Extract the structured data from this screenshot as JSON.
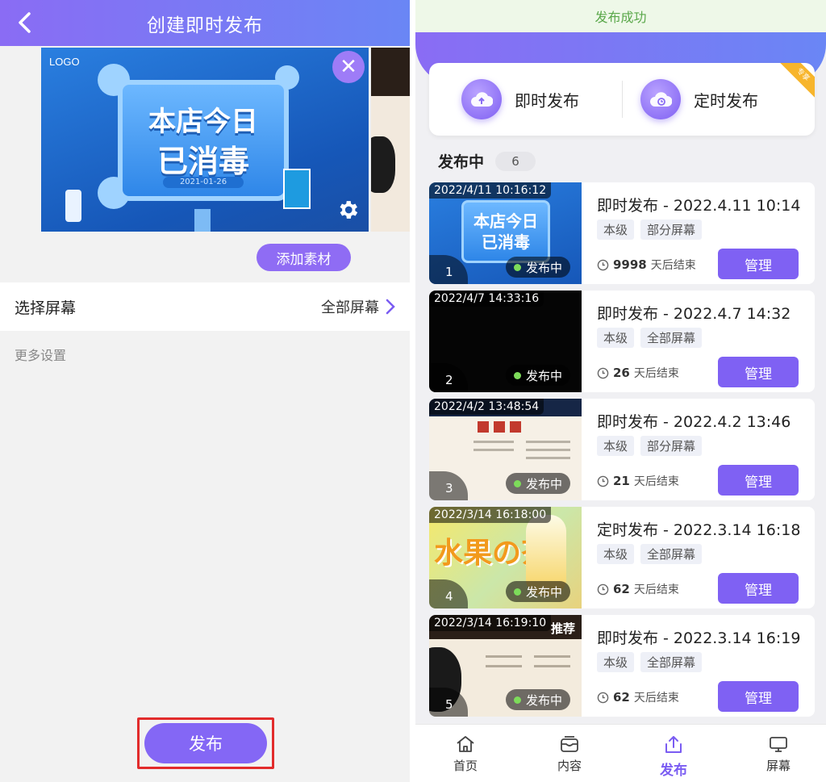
{
  "left": {
    "header": {
      "back_icon": "chevron-left-icon",
      "title": "创建即时发布"
    },
    "material": {
      "logo_text": "LOGO",
      "board_line1": "本店今日",
      "board_line2": "已消毒",
      "board_date": "2021-01-26",
      "close_icon": "close-icon",
      "settings_icon": "gear-icon"
    },
    "add_material_label": "添加素材",
    "select_screen": {
      "label": "选择屏幕",
      "value": "全部屏幕"
    },
    "more_settings": "更多设置",
    "publish_button": "发布"
  },
  "right": {
    "toast": "发布成功",
    "quick": {
      "instant_label": "即时发布",
      "scheduled_label": "定时发布",
      "pro_badge": "专享"
    },
    "section": {
      "title": "发布中",
      "count": "6"
    },
    "items": [
      {
        "timestamp": "2022/4/11 10:16:12",
        "index": "1",
        "status": "发布中",
        "title": "即时发布 - 2022.4.11 10:14",
        "tag1": "本级",
        "tag2": "部分屏幕",
        "remain_num": "9998",
        "remain_text": "天后结束",
        "manage": "管理",
        "thumb": "blue",
        "thumb_text1": "本店今日",
        "thumb_text2": "已消毒"
      },
      {
        "timestamp": "2022/4/7 14:33:16",
        "index": "2",
        "status": "发布中",
        "title": "即时发布 - 2022.4.7 14:32",
        "tag1": "本级",
        "tag2": "全部屏幕",
        "remain_num": "26",
        "remain_text": "天后结束",
        "manage": "管理",
        "thumb": "black"
      },
      {
        "timestamp": "2022/4/2 13:48:54",
        "index": "3",
        "status": "发布中",
        "title": "即时发布 - 2022.4.2 13:46",
        "tag1": "本级",
        "tag2": "部分屏幕",
        "remain_num": "21",
        "remain_text": "天后结束",
        "manage": "管理",
        "thumb": "menu"
      },
      {
        "timestamp": "2022/3/14 16:18:00",
        "index": "4",
        "status": "发布中",
        "title": "定时发布 - 2022.3.14 16:18",
        "tag1": "本级",
        "tag2": "全部屏幕",
        "remain_num": "62",
        "remain_text": "天后结束",
        "manage": "管理",
        "thumb": "fruit",
        "thumb_text1": "水果の茶"
      },
      {
        "timestamp": "2022/3/14 16:19:10",
        "index": "5",
        "status": "发布中",
        "title": "即时发布 - 2022.3.14 16:19",
        "tag1": "本级",
        "tag2": "全部屏幕",
        "remain_num": "62",
        "remain_text": "天后结束",
        "manage": "管理",
        "thumb": "cafe",
        "thumb_text1": "推荐"
      }
    ],
    "tabs": [
      {
        "label": "首页",
        "icon": "home-icon"
      },
      {
        "label": "内容",
        "icon": "content-box-icon"
      },
      {
        "label": "发布",
        "icon": "upload-icon"
      },
      {
        "label": "屏幕",
        "icon": "monitor-icon"
      }
    ],
    "colors": {
      "accent": "#7f61f3",
      "success": "#5aa84a"
    }
  }
}
